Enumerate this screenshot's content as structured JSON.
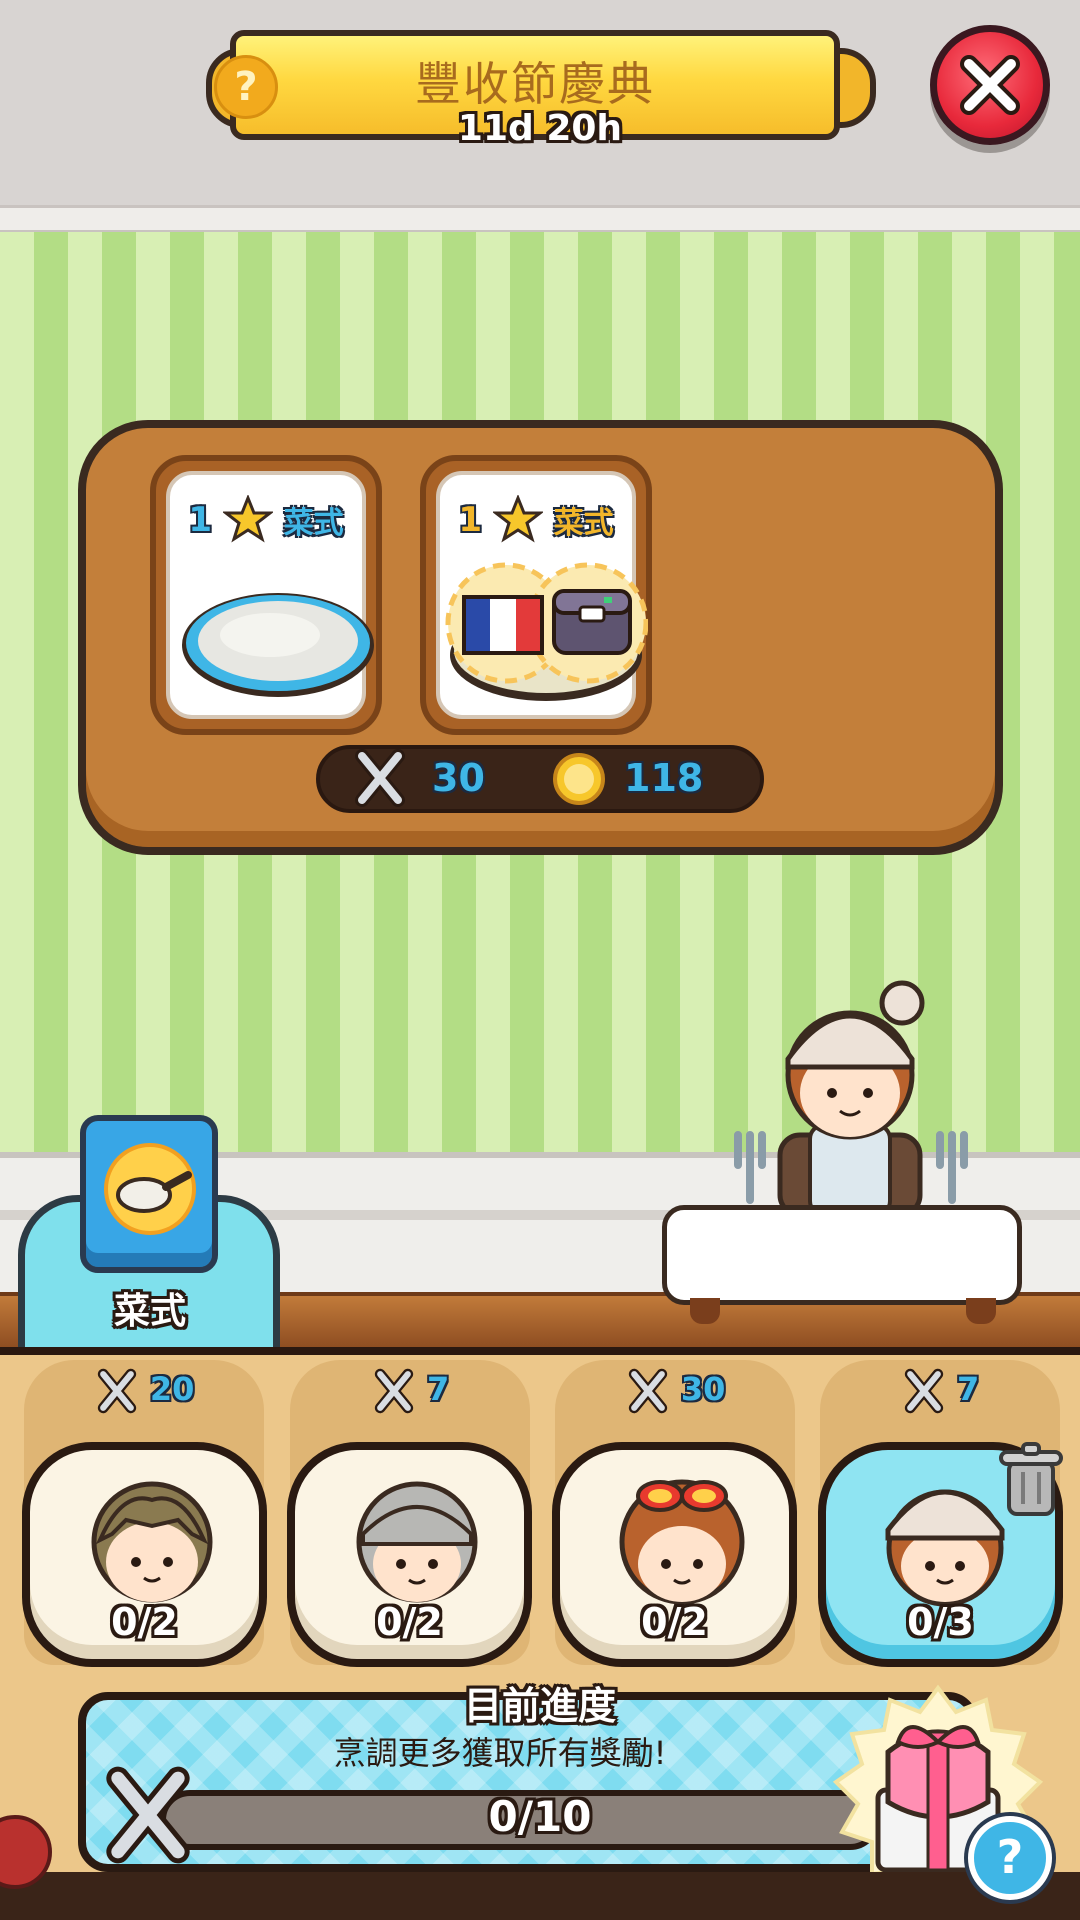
{
  "header": {
    "title": "豐收節慶典",
    "timer": "11d 20h",
    "help_symbol": "?",
    "close_icon": "close-icon"
  },
  "dishes": [
    {
      "stars": "1",
      "label": "菜式",
      "type": "empty-plate",
      "accent": "#3fb6e6"
    },
    {
      "stars": "1",
      "label": "菜式",
      "type": "french-lunchbox",
      "accent": "#f2b62a"
    }
  ],
  "board_stats": {
    "points": "30",
    "coins": "118"
  },
  "recipe_book": {
    "label": "菜式"
  },
  "customers": [
    {
      "points": "20",
      "progress": "0/2",
      "hair": "#8a7a50",
      "selected": false
    },
    {
      "points": "7",
      "progress": "0/2",
      "hair": "#b7b7b4",
      "selected": false
    },
    {
      "points": "30",
      "progress": "0/2",
      "hair": "#b9622d",
      "selected": false
    },
    {
      "points": "7",
      "progress": "0/3",
      "hair": "#b9622d",
      "selected": true
    }
  ],
  "progress": {
    "heading": "目前進度",
    "subtext": "烹調更多獲取所有獎勵!",
    "count": "0/10",
    "fraction": 0,
    "help_symbol": "?"
  },
  "colors": {
    "accent_blue": "#3fb6e6",
    "accent_gold": "#f2b62a",
    "close_red": "#e8293b"
  }
}
